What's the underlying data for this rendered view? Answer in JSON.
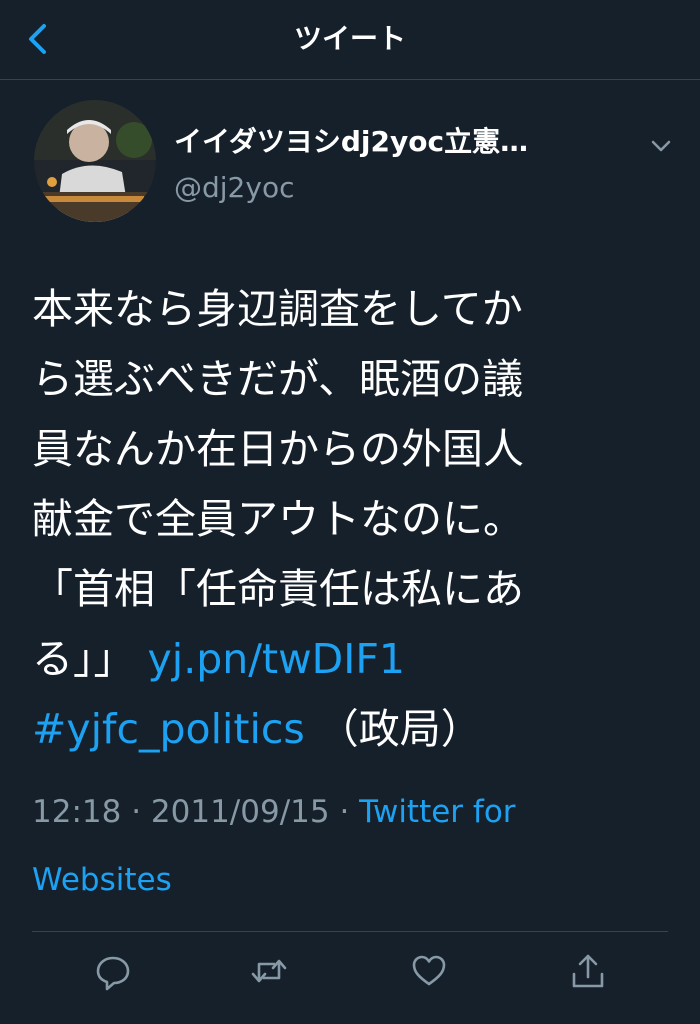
{
  "nav": {
    "title": "ツイート"
  },
  "tweet": {
    "author_name": "イイダツヨシdj2yoc立憲…",
    "handle": "@dj2yoc",
    "text_lines": [
      "本来なら身辺調査をしてか",
      "ら選ぶべきだが、眠酒の議",
      "員なんか在日からの外国人",
      "献金で全員アウトなのに。",
      "「首相「任命責任は私にあ"
    ],
    "last_line_text": "る」」 ",
    "link_text": "yj.pn/twDIF1",
    "hashtag": "#yjfc_politics",
    "hashtag_suffix": " （政局）",
    "time": "12:18",
    "separator": " · ",
    "date": "2011/09/15",
    "separator2": " · ",
    "source": "Twitter for Websites"
  },
  "colors": {
    "background": "#15202b",
    "accent": "#1da1f2",
    "muted": "#8899a6",
    "border": "#38444d"
  },
  "icons": {
    "back": "chevron-left-icon",
    "caret": "chevron-down-icon",
    "actions": [
      "reply-icon",
      "retweet-icon",
      "like-icon",
      "share-icon"
    ]
  }
}
